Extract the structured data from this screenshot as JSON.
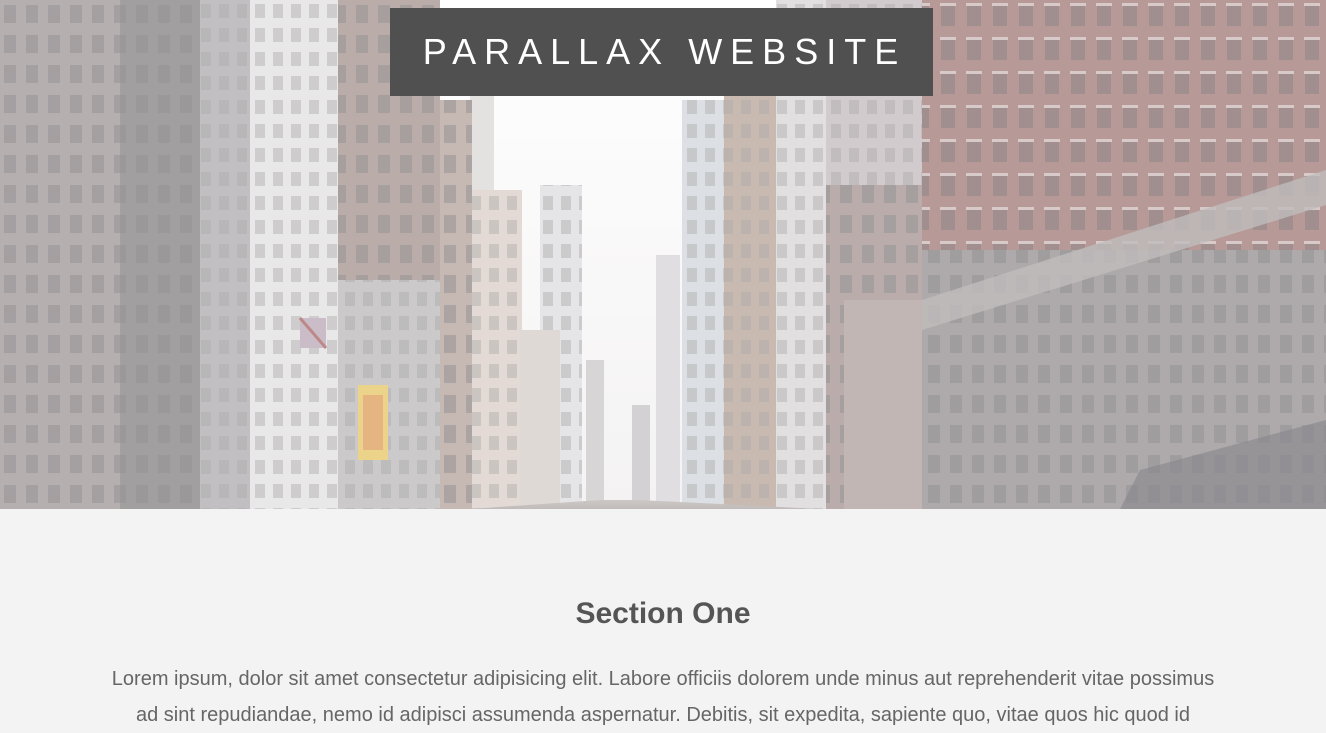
{
  "hero": {
    "title": "Parallax Website",
    "image": "city-street-photo",
    "overlay_color": "#505050"
  },
  "section_one": {
    "heading": "Section One",
    "body": "Lorem ipsum, dolor sit amet consectetur adipisicing elit. Labore officiis dolorem unde minus aut reprehenderit vitae possimus ad sint repudiandae, nemo id adipisci assumenda aspernatur. Debitis, sit expedita, sapiente quo, vitae quos hic quod id"
  },
  "colors": {
    "page_background": "#f3f3f3",
    "heading": "#555555",
    "body_text": "#666666"
  }
}
